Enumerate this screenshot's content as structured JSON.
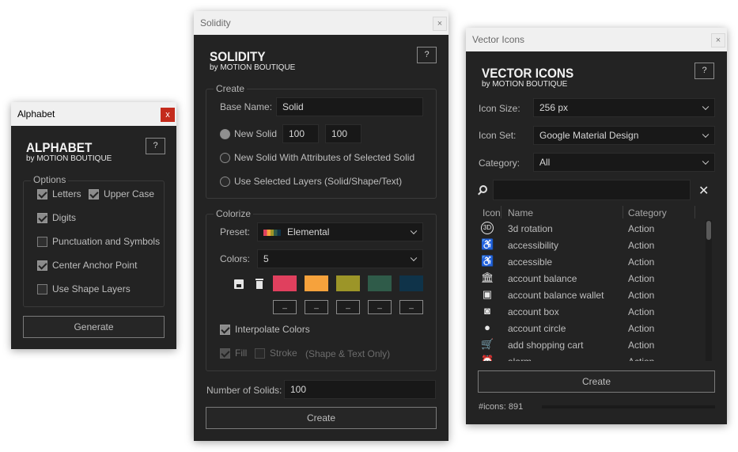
{
  "alphabet": {
    "window_title": "Alphabet",
    "close": "x",
    "logo_title": "ALPHABET",
    "logo_sub": "by MOTION BOUTIQUE",
    "help": "?",
    "options_label": "Options",
    "letters": "Letters",
    "upper_case": "Upper Case",
    "digits": "Digits",
    "punctuation": "Punctuation and Symbols",
    "center_anchor": "Center Anchor Point",
    "use_shape_layers": "Use Shape Layers",
    "generate": "Generate"
  },
  "solidity": {
    "window_title": "Solidity",
    "close": "×",
    "logo_title": "SOLIDITY",
    "logo_sub": "by MOTION BOUTIQUE",
    "help": "?",
    "create_group": "Create",
    "base_name_label": "Base Name:",
    "base_name_value": "Solid",
    "new_solid": "New Solid",
    "width_value": "100",
    "height_value": "100",
    "new_solid_attrs": "New Solid With Attributes of Selected Solid",
    "use_selected": "Use Selected Layers (Solid/Shape/Text)",
    "colorize_group": "Colorize",
    "preset_label": "Preset:",
    "preset_value": "Elemental",
    "colors_label": "Colors:",
    "colors_value": "5",
    "swatches": [
      "#e0405e",
      "#f6a23c",
      "#9c9528",
      "#2f5b49",
      "#0f3349"
    ],
    "swatch_edit": "_",
    "interpolate": "Interpolate Colors",
    "fill": "Fill",
    "stroke": "Stroke",
    "shape_text_only": "(Shape & Text Only)",
    "num_solids_label": "Number of Solids:",
    "num_solids_value": "100",
    "create": "Create"
  },
  "vector": {
    "window_title": "Vector Icons",
    "close": "×",
    "logo_title": "VECTOR ICONS",
    "logo_sub": "by MOTION BOUTIQUE",
    "help": "?",
    "icon_size_label": "Icon Size:",
    "icon_size_value": "256 px",
    "icon_set_label": "Icon Set:",
    "icon_set_value": "Google Material Design",
    "category_label": "Category:",
    "category_value": "All",
    "search_value": "",
    "columns": [
      "Icon",
      "Name",
      "Category"
    ],
    "rows": [
      {
        "icon": "3D",
        "name": "3d rotation",
        "category": "Action"
      },
      {
        "icon": "♿",
        "name": "accessibility",
        "category": "Action"
      },
      {
        "icon": "♿",
        "name": "accessible",
        "category": "Action"
      },
      {
        "icon": "🏛",
        "name": "account balance",
        "category": "Action"
      },
      {
        "icon": "▣",
        "name": "account balance wallet",
        "category": "Action"
      },
      {
        "icon": "◙",
        "name": "account box",
        "category": "Action"
      },
      {
        "icon": "●",
        "name": "account circle",
        "category": "Action"
      },
      {
        "icon": "🛒",
        "name": "add shopping cart",
        "category": "Action"
      },
      {
        "icon": "⏰",
        "name": "alarm",
        "category": "Action"
      }
    ],
    "create": "Create",
    "icon_count": "#icons: 891"
  }
}
